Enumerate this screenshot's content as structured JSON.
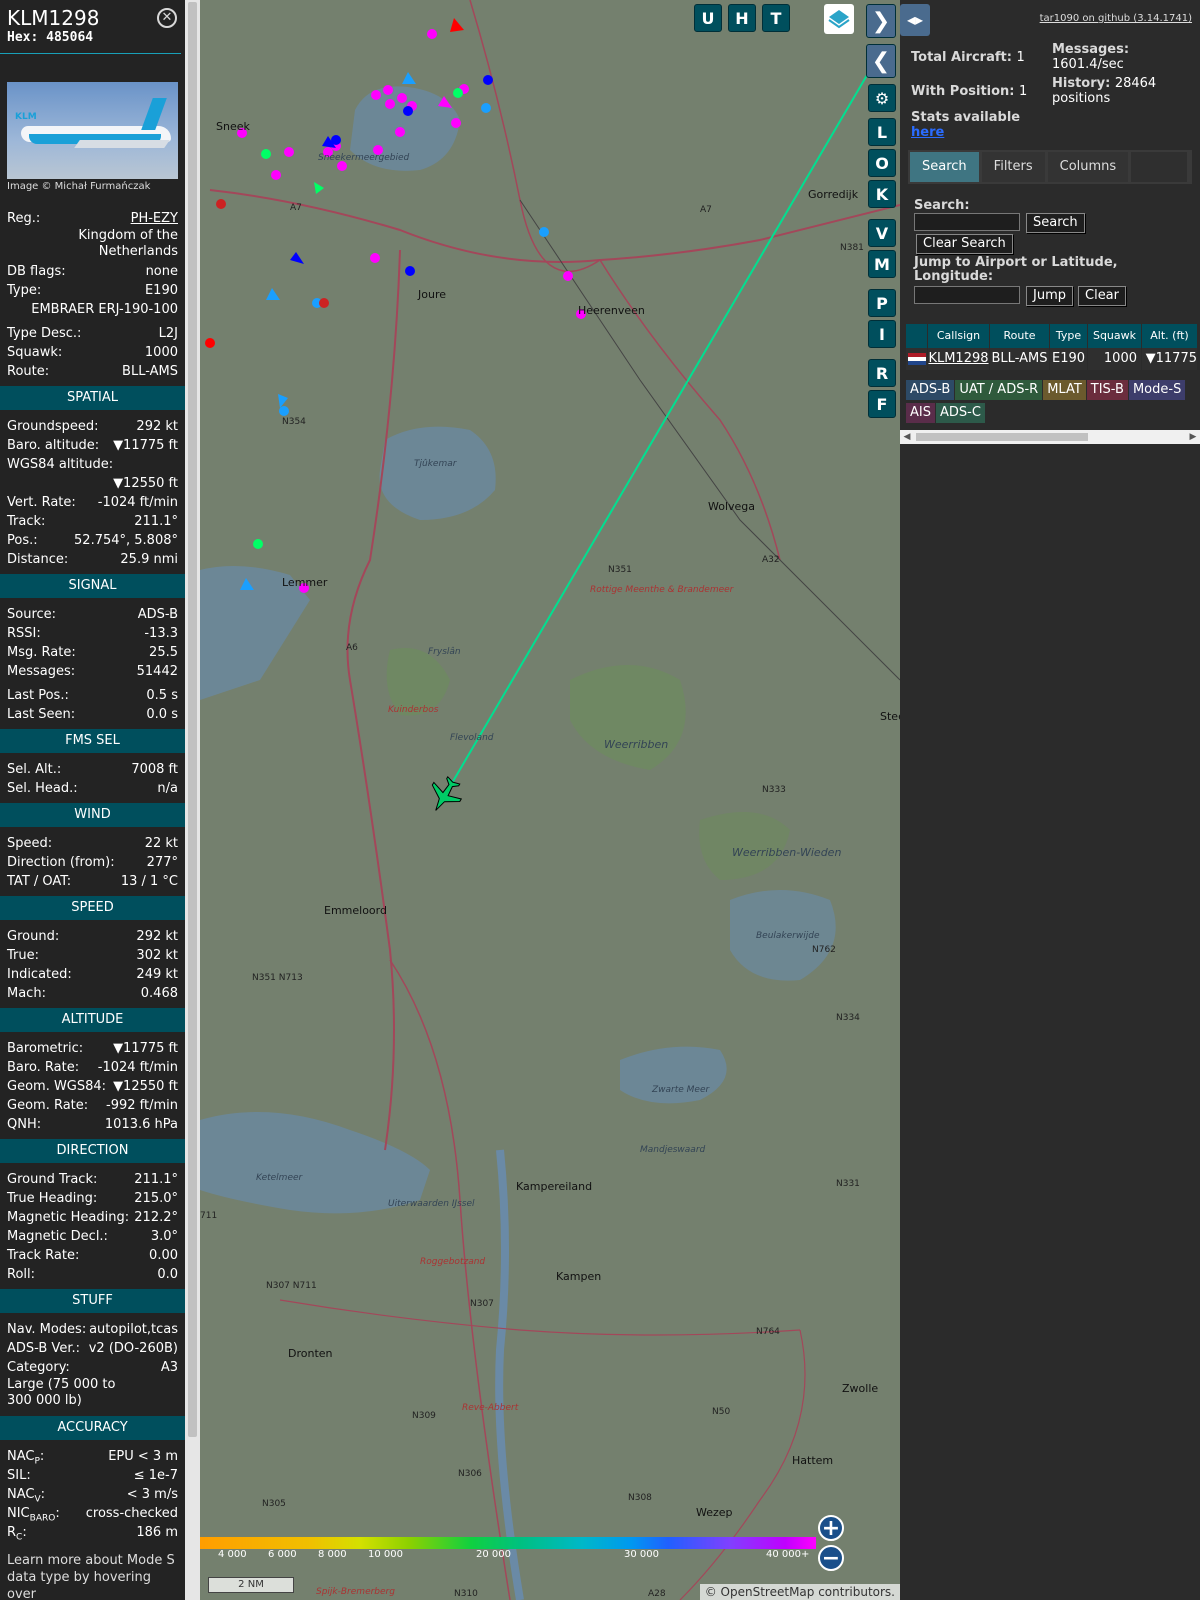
{
  "aircraft": {
    "callsign": "KLM1298",
    "hex_label": "Hex:",
    "hex": "485064",
    "close_label": "⊗",
    "image_credit": "Image © Michał Furmańczak",
    "photo_logo": "KLM",
    "reg_label": "Reg.:",
    "reg": "PH-EZY",
    "country": "Kingdom of the Netherlands",
    "dbflags_label": "DB flags:",
    "dbflags": "none",
    "type_label": "Type:",
    "type": "E190",
    "model": "EMBRAER ERJ-190-100",
    "typedesc_label": "Type Desc.:",
    "typedesc": "L2J",
    "squawk_label": "Squawk:",
    "squawk": "1000",
    "route_label": "Route:",
    "route": "BLL-AMS"
  },
  "sections": {
    "spatial": "SPATIAL",
    "signal": "SIGNAL",
    "fms": "FMS SEL",
    "wind": "WIND",
    "speed": "SPEED",
    "altitude": "ALTITUDE",
    "direction": "DIRECTION",
    "stuff": "STUFF",
    "accuracy": "ACCURACY"
  },
  "spatial": [
    {
      "k": "Groundspeed:",
      "v": "292 kt"
    },
    {
      "k": "Baro. altitude:",
      "v": "▼11775 ft"
    },
    {
      "k": "WGS84 altitude:",
      "v": ""
    },
    {
      "k": "",
      "v": "▼12550 ft"
    },
    {
      "k": "Vert. Rate:",
      "v": "-1024 ft/min"
    },
    {
      "k": "Track:",
      "v": "211.1°"
    },
    {
      "k": "Pos.:",
      "v": "52.754°, 5.808°"
    },
    {
      "k": "Distance:",
      "v": "25.9 nmi"
    }
  ],
  "signal": [
    {
      "k": "Source:",
      "v": "ADS-B"
    },
    {
      "k": "RSSI:",
      "v": "-13.3"
    },
    {
      "k": "Msg. Rate:",
      "v": "25.5"
    },
    {
      "k": "Messages:",
      "v": "51442"
    },
    {
      "k": "Last Pos.:",
      "v": "0.5 s"
    },
    {
      "k": "Last Seen:",
      "v": "0.0 s"
    }
  ],
  "fms": [
    {
      "k": "Sel. Alt.:",
      "v": "7008 ft"
    },
    {
      "k": "Sel. Head.:",
      "v": "n/a"
    }
  ],
  "wind": [
    {
      "k": "Speed:",
      "v": "22 kt"
    },
    {
      "k": "Direction (from):",
      "v": "277°"
    },
    {
      "k": "TAT / OAT:",
      "v": "13 / 1 °C"
    }
  ],
  "speed": [
    {
      "k": "Ground:",
      "v": "292 kt"
    },
    {
      "k": "True:",
      "v": "302 kt"
    },
    {
      "k": "Indicated:",
      "v": "249 kt"
    },
    {
      "k": "Mach:",
      "v": "0.468"
    }
  ],
  "altitude": [
    {
      "k": "Barometric:",
      "v": "▼11775 ft"
    },
    {
      "k": "Baro. Rate:",
      "v": "-1024 ft/min"
    },
    {
      "k": "Geom. WGS84:",
      "v": "▼12550 ft"
    },
    {
      "k": "Geom. Rate:",
      "v": "-992 ft/min"
    },
    {
      "k": "QNH:",
      "v": "1013.6 hPa"
    }
  ],
  "direction": [
    {
      "k": "Ground Track:",
      "v": "211.1°"
    },
    {
      "k": "True Heading:",
      "v": "215.0°"
    },
    {
      "k": "Magnetic Heading:",
      "v": "212.2°"
    },
    {
      "k": "Magnetic Decl.:",
      "v": "3.0°"
    },
    {
      "k": "Track Rate:",
      "v": "0.00"
    },
    {
      "k": "Roll:",
      "v": "0.0"
    }
  ],
  "stuff": {
    "nav_label": "Nav. Modes:",
    "nav": "autopilot,tcas",
    "adsb_label": "ADS-B Ver.:",
    "adsb": "v2 (DO-260B)",
    "cat_label": "Category:",
    "cat": "A3",
    "cat_desc": "Large (75 000 to 300 000 lb)"
  },
  "accuracy": {
    "nacp_k": "NAC",
    "nacp_sub": "P",
    "nacp_v": "EPU < 3 m",
    "sil_k": "SIL:",
    "sil_v": "≤ 1e-7",
    "nacv_k": "NAC",
    "nacv_sub": "V",
    "nacv_v": "< 3 m/s",
    "nic_k": "NIC",
    "nic_sub": "BARO",
    "nic_v": "cross-checked",
    "rc_k": "R",
    "rc_sub": "C",
    "rc_v": "186 m"
  },
  "learn_more": "Learn more about Mode S data type by hovering over",
  "map": {
    "buttons_top": [
      "U",
      "H",
      "T"
    ],
    "buttons_side": [
      "L",
      "O",
      "K",
      "V",
      "M",
      "P",
      "I",
      "R",
      "F"
    ],
    "zoom_in": "+",
    "zoom_out": "−",
    "scale": "2 NM",
    "attribution": "© OpenStreetMap contributors.",
    "alt_ticks": [
      "4 000",
      "6 000",
      "8 000",
      "10 000",
      "20 000",
      "30 000",
      "40 000+"
    ],
    "towns": [
      "Sneek",
      "Joure",
      "Heerenveen",
      "Gorredijk",
      "Wolvega",
      "Lemmer",
      "Emmeloord",
      "Kampen",
      "Dronten",
      "Zwolle",
      "Hattem",
      "Wezep",
      "Kampereiland",
      "Steenwijk"
    ],
    "places": [
      "Sneekermeergebied",
      "Tjûkemar",
      "Rottige Meenthe & Brandemeer",
      "Weerribben",
      "Weerribben-Wieden",
      "Beulakerwijde",
      "Kuinderbos",
      "Flevoland",
      "Zwarte Meer",
      "Mandjeswaard",
      "Ketelmeer",
      "Uiterwaarden IJssel",
      "Roggebotzand",
      "Reve-Abbert",
      "Fryslân",
      "Spijk-Bremerberg"
    ],
    "roads": [
      "A7",
      "A7",
      "A6",
      "A32",
      "N351",
      "N333",
      "N762",
      "N334",
      "N331",
      "N351 N713",
      "N307 N711",
      "N307",
      "N764",
      "N50",
      "N309",
      "N306",
      "N308",
      "N305",
      "N310",
      "A28",
      "N354",
      "N381",
      "711"
    ]
  },
  "sidebar": {
    "toggle": "◂▸",
    "github": "tar1090 on github (3.14.1741)",
    "total_label": "Total Aircraft:",
    "total": "1",
    "withpos_label": "With Position:",
    "withpos": "1",
    "stats_label": "Stats available",
    "stats_link": "here",
    "msgs_label": "Messages:",
    "msgs": "1601.4/sec",
    "history_label": "History:",
    "history": "28464 positions",
    "tabs": [
      "Search",
      "Filters",
      "Columns"
    ],
    "search_label": "Search:",
    "search_btn": "Search",
    "clear_search_btn": "Clear Search",
    "jump_label": "Jump to Airport or Latitude, Longitude:",
    "jump_btn": "Jump",
    "clear_btn": "Clear"
  },
  "table": {
    "headers": [
      "",
      "Callsign",
      "Route",
      "Type",
      "Squawk",
      "Alt. (ft)"
    ],
    "rows": [
      {
        "callsign": "KLM1298",
        "route": "BLL-AMS",
        "type": "E190",
        "squawk": "1000",
        "alt": "▼11775"
      }
    ]
  },
  "chips": [
    {
      "label": "ADS-B",
      "bg": "#2d4a66"
    },
    {
      "label": "UAT / ADS-R",
      "bg": "#2f5a3c"
    },
    {
      "label": "MLAT",
      "bg": "#6b5a2d"
    },
    {
      "label": "TIS-B",
      "bg": "#6b2d3d"
    },
    {
      "label": "Mode-S",
      "bg": "#3d3d6b"
    },
    {
      "label": "AIS",
      "bg": "#5a2d4a"
    },
    {
      "label": "ADS-C",
      "bg": "#2d5a4a"
    }
  ],
  "colors": {
    "section_bg": "#004f5d",
    "accent": "#18a0b8",
    "trail": "#00e090",
    "aircraft": "#00cc66"
  }
}
